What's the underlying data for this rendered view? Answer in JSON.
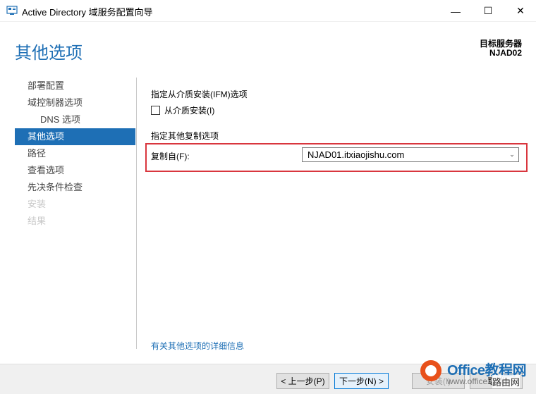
{
  "window": {
    "title": "Active Directory 域服务配置向导",
    "minimize_glyph": "—",
    "maximize_glyph": "☐",
    "close_glyph": "✕"
  },
  "header": {
    "page_title": "其他选项",
    "target_label": "目标服务器",
    "target_name": "NJAD02"
  },
  "nav": {
    "items": [
      {
        "label": "部署配置",
        "state": "normal"
      },
      {
        "label": "域控制器选项",
        "state": "normal"
      },
      {
        "label": "DNS 选项",
        "state": "sub"
      },
      {
        "label": "其他选项",
        "state": "active"
      },
      {
        "label": "路径",
        "state": "normal"
      },
      {
        "label": "查看选项",
        "state": "normal"
      },
      {
        "label": "先决条件检查",
        "state": "normal"
      },
      {
        "label": "安装",
        "state": "disabled"
      },
      {
        "label": "结果",
        "state": "disabled"
      }
    ]
  },
  "main": {
    "ifm_section": "指定从介质安装(IFM)选项",
    "ifm_checkbox_label": "从介质安装(I)",
    "ifm_checked": false,
    "replication_section": "指定其他复制选项",
    "replicate_from_label": "复制自(F):",
    "replicate_from_value": "NJAD01.itxiaojishu.com",
    "more_link": "有关其他选项的详细信息"
  },
  "footer": {
    "prev": "< 上一步(P)",
    "next": "下一步(N) >",
    "install": "安装(I)",
    "cancel": "取消"
  },
  "watermark": {
    "brand": "Office教程网",
    "url": "www.office26.com",
    "corner": "路由网"
  },
  "colors": {
    "accent": "#1e6fb5",
    "highlight": "#d9363e",
    "brand_orange": "#e8501a"
  }
}
